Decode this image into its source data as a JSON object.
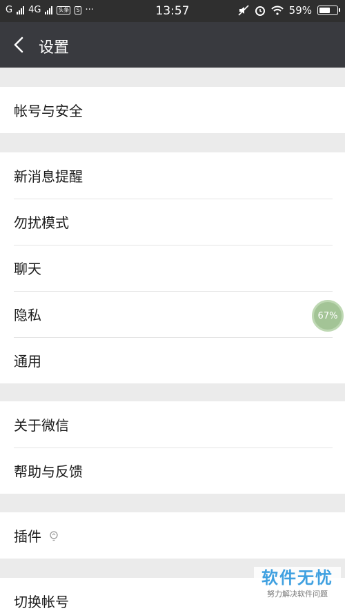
{
  "status_bar": {
    "carrier_g": "G",
    "network": "4G",
    "badge_1": "头条",
    "badge_2": "S",
    "more": "···",
    "time": "13:57",
    "battery": "59%"
  },
  "header": {
    "title": "设置"
  },
  "groups": [
    {
      "items": [
        "帐号与安全"
      ]
    },
    {
      "items": [
        "新消息提醒",
        "勿扰模式",
        "聊天",
        "隐私",
        "通用"
      ]
    },
    {
      "items": [
        "关于微信",
        "帮助与反馈"
      ]
    },
    {
      "items": [
        "插件"
      ]
    },
    {
      "items": [
        "切换帐号"
      ]
    }
  ],
  "float_ball": {
    "label": "67%",
    "color": "#9cbf8e"
  },
  "watermark": {
    "main": "软件无忧",
    "sub": "努力解决软件问题"
  },
  "colors": {
    "titlebar": "#393a3f",
    "statusbar": "#2f2f2f",
    "background": "#ebebeb",
    "watermark": "#3fa0e0"
  }
}
